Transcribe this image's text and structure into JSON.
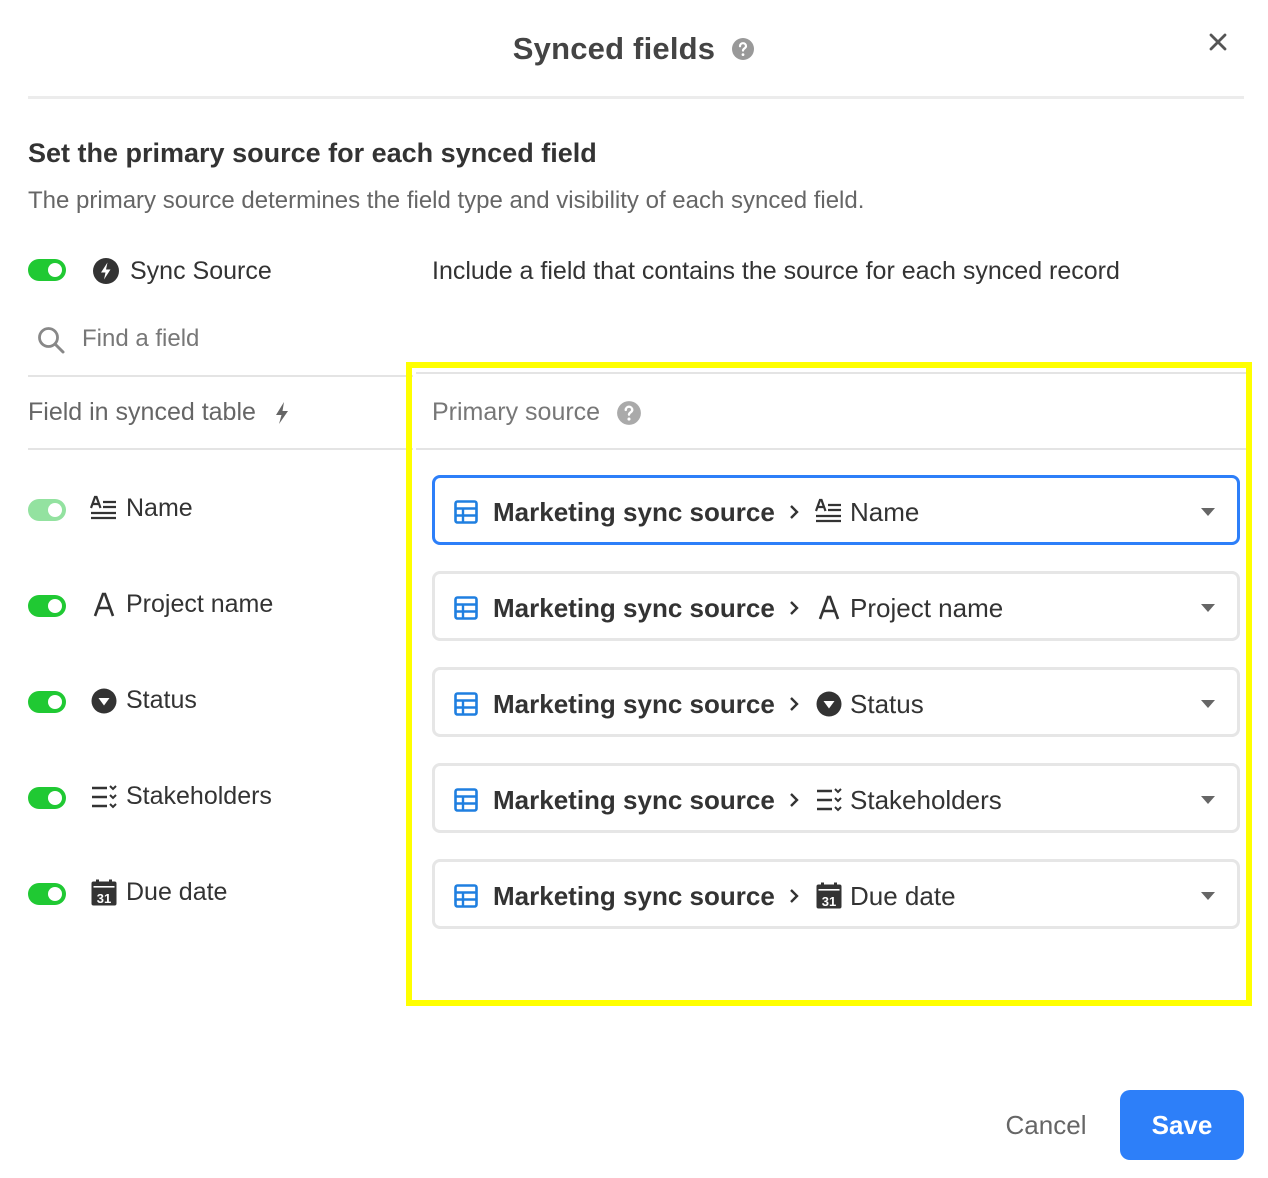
{
  "dialog": {
    "title": "Synced fields",
    "heading": "Set the primary source for each synced field",
    "description": "The primary source determines the field type and visibility of each synced field."
  },
  "sync_source": {
    "label": "Sync Source",
    "description": "Include a field that contains the source for each synced record",
    "enabled": true
  },
  "search": {
    "placeholder": "Find a field"
  },
  "columns": {
    "left": "Field in synced table",
    "right": "Primary source"
  },
  "fields": [
    {
      "name": "Name",
      "icon": "long-text-icon",
      "enabled": true,
      "locked": true,
      "source": "Marketing sync source",
      "source_field": "Name"
    },
    {
      "name": "Project name",
      "icon": "single-line-text-icon",
      "enabled": true,
      "locked": false,
      "source": "Marketing sync source",
      "source_field": "Project name"
    },
    {
      "name": "Status",
      "icon": "single-select-icon",
      "enabled": true,
      "locked": false,
      "source": "Marketing sync source",
      "source_field": "Status"
    },
    {
      "name": "Stakeholders",
      "icon": "multi-select-icon",
      "enabled": true,
      "locked": false,
      "source": "Marketing sync source",
      "source_field": "Stakeholders"
    },
    {
      "name": "Due date",
      "icon": "calendar-icon",
      "enabled": true,
      "locked": false,
      "source": "Marketing sync source",
      "source_field": "Due date"
    }
  ],
  "footer": {
    "cancel_label": "Cancel",
    "save_label": "Save"
  },
  "colors": {
    "accent": "#2d7ff9",
    "toggle_on": "#20c933",
    "highlight": "#ffff00"
  }
}
